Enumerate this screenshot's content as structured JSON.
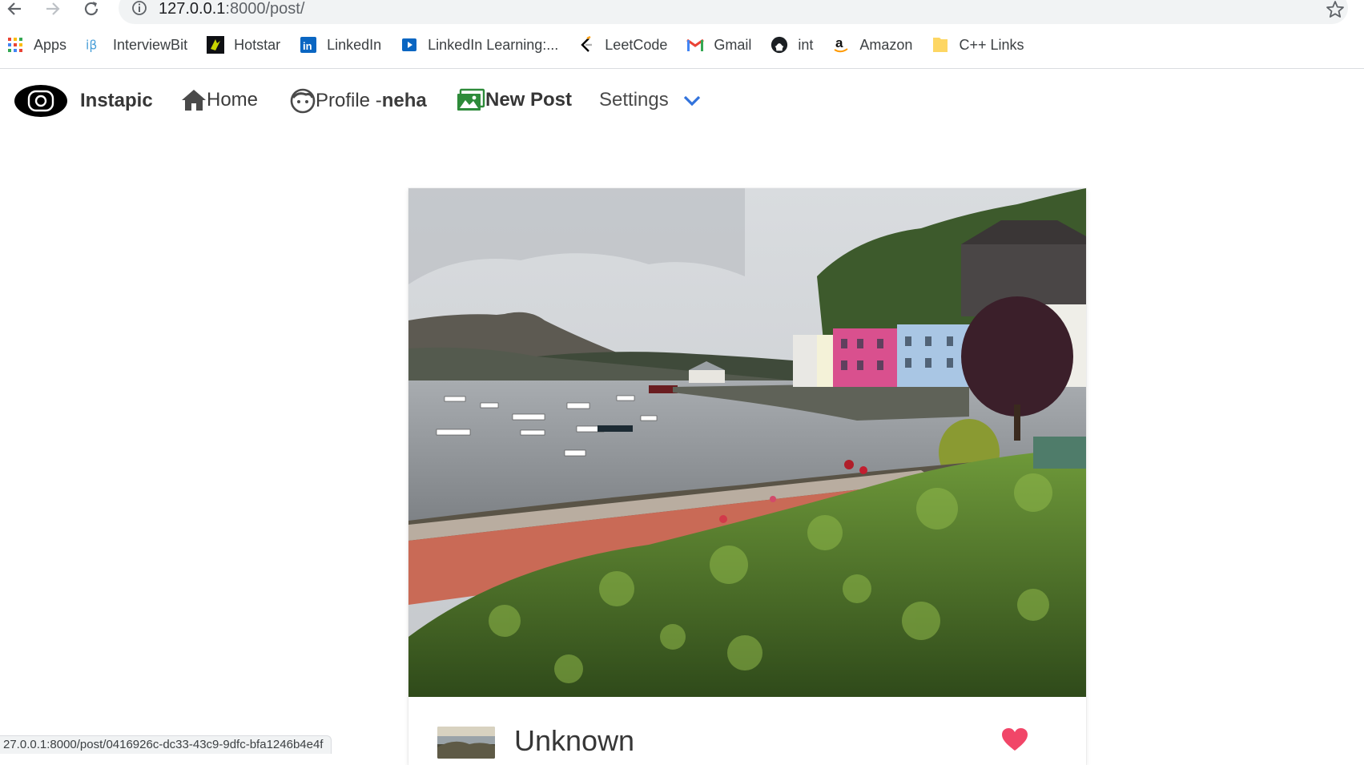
{
  "browser": {
    "url_host": "127.0.0.1",
    "url_path": ":8000/post/",
    "status_url": "27.0.0.1:8000/post/0416926c-dc33-43c9-9dfc-bfa1246b4e4f"
  },
  "bookmarks": [
    {
      "label": "Apps",
      "icon": "apps-grid-icon"
    },
    {
      "label": "InterviewBit",
      "icon": "interviewbit-icon"
    },
    {
      "label": "Hotstar",
      "icon": "hotstar-icon"
    },
    {
      "label": "LinkedIn",
      "icon": "linkedin-icon"
    },
    {
      "label": "LinkedIn Learning:...",
      "icon": "linkedin-learning-icon"
    },
    {
      "label": "LeetCode",
      "icon": "leetcode-icon"
    },
    {
      "label": "Gmail",
      "icon": "gmail-icon"
    },
    {
      "label": "int",
      "icon": "github-icon"
    },
    {
      "label": "Amazon",
      "icon": "amazon-icon"
    },
    {
      "label": "C++ Links",
      "icon": "folder-icon"
    }
  ],
  "navbar": {
    "brand": "Instapic",
    "home": "Home",
    "profile_prefix": "Profile -",
    "profile_user": "neha",
    "new_post": "New Post",
    "settings": "Settings"
  },
  "post": {
    "title": "Unknown"
  },
  "colors": {
    "accent_blue": "#3273dc",
    "new_post_green": "#48c774",
    "like_red": "#f14668"
  }
}
